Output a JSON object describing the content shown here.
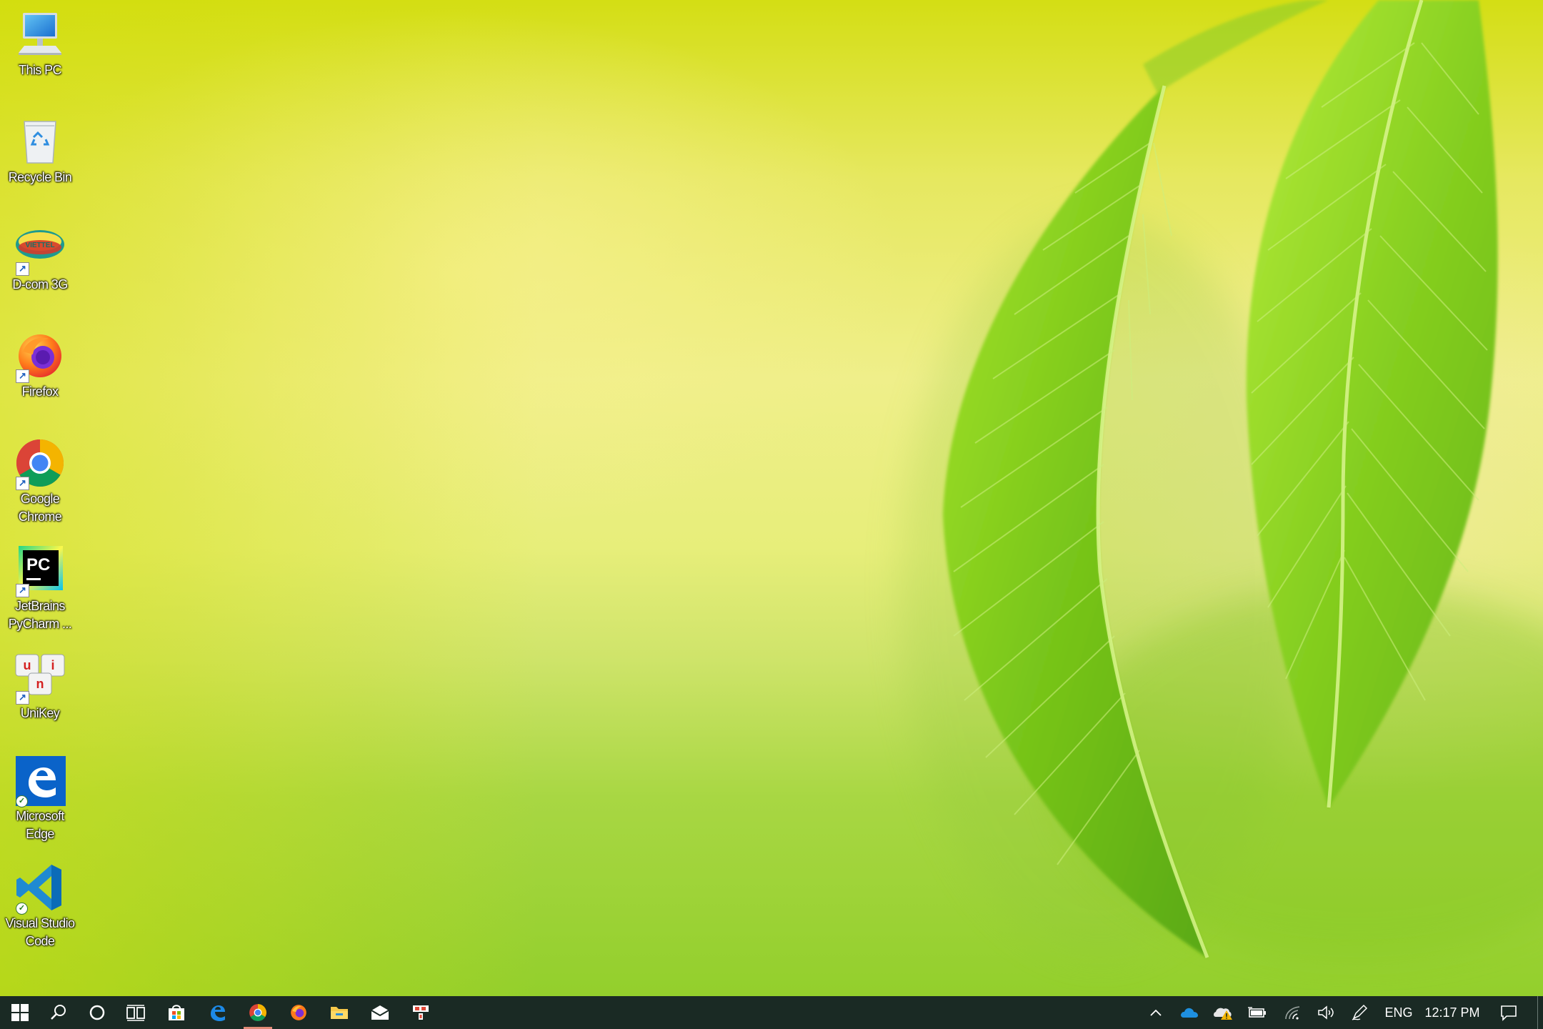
{
  "desktop": {
    "icons": [
      {
        "label": "This PC",
        "icon": "monitor-icon"
      },
      {
        "label": "Recycle Bin",
        "icon": "recycle-bin-icon"
      },
      {
        "label": "D-com 3G",
        "icon": "viettel-icon",
        "logo_text": "VIETTEL"
      },
      {
        "label": "Firefox",
        "icon": "firefox-icon"
      },
      {
        "label": "Google Chrome",
        "icon": "chrome-icon"
      },
      {
        "label": "JetBrains PyCharm ...",
        "icon": "pycharm-icon",
        "logo_text": "PC"
      },
      {
        "label": "UniKey",
        "icon": "unikey-icon",
        "keys": [
          "u",
          "i",
          "n"
        ]
      },
      {
        "label": "Microsoft Edge",
        "icon": "edge-icon"
      },
      {
        "label": "Visual Studio Code",
        "icon": "vscode-icon"
      }
    ]
  },
  "taskbar": {
    "pinned": [
      {
        "name": "start",
        "icon": "windows-logo-icon"
      },
      {
        "name": "search",
        "icon": "search-icon"
      },
      {
        "name": "cortana",
        "icon": "cortana-circle-icon"
      },
      {
        "name": "task-view",
        "icon": "task-view-icon"
      },
      {
        "name": "microsoft-store",
        "icon": "store-icon"
      },
      {
        "name": "edge",
        "icon": "edge-icon"
      },
      {
        "name": "chrome",
        "icon": "chrome-icon",
        "active": true
      },
      {
        "name": "firefox",
        "icon": "firefox-icon"
      },
      {
        "name": "file-explorer",
        "icon": "folder-icon"
      },
      {
        "name": "mail",
        "icon": "mail-icon"
      },
      {
        "name": "snipping",
        "icon": "snipping-icon"
      }
    ],
    "tray": {
      "language": "ENG",
      "time": "12:17 PM",
      "icons": [
        "chevron-up-icon",
        "onedrive-icon",
        "weather-alert-icon",
        "battery-icon",
        "wifi-icon",
        "volume-icon",
        "pen-icon",
        "notification-icon"
      ]
    }
  },
  "colors": {
    "taskbar_bg": "#1a2a24",
    "active_indicator": "#e08a75",
    "label_text": "#ffffff"
  }
}
